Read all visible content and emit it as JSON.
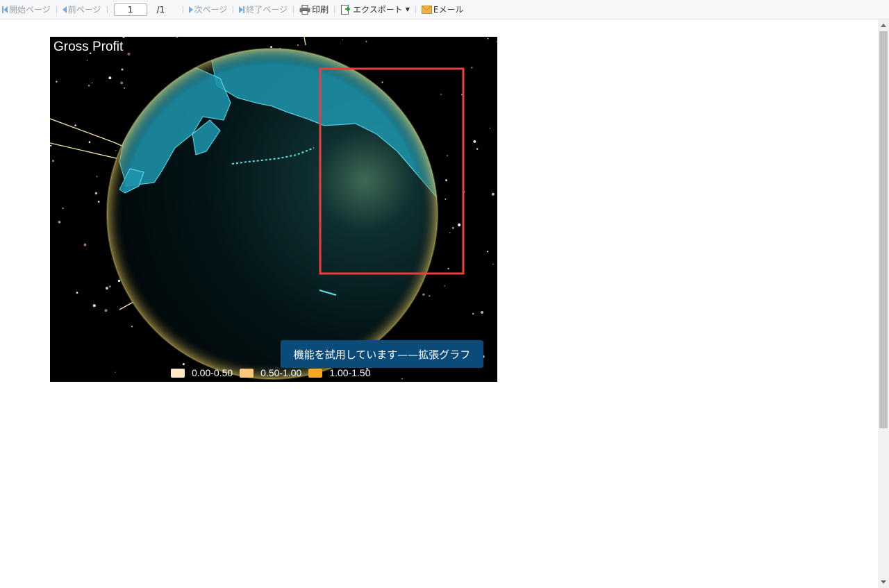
{
  "toolbar": {
    "first_page": "開始ページ",
    "prev_page": "前ページ",
    "page_value": "1",
    "page_total": "/1",
    "next_page": "次ページ",
    "last_page": "終了ページ",
    "print": "印刷",
    "export": "エクスポート",
    "email": "Eメール"
  },
  "chart": {
    "title": "Gross Profit",
    "watermark": "機能を試用しています——拡張グラフ",
    "legend": [
      {
        "label": "0.00-0.50",
        "color": "#fde6c4"
      },
      {
        "label": "0.50-1.00",
        "color": "#fbc878"
      },
      {
        "label": "1.00-1.50",
        "color": "#f6a723"
      }
    ]
  },
  "colors": {
    "selection": "#e8403c",
    "land": "#1e95ad",
    "ocean": "#021418"
  }
}
